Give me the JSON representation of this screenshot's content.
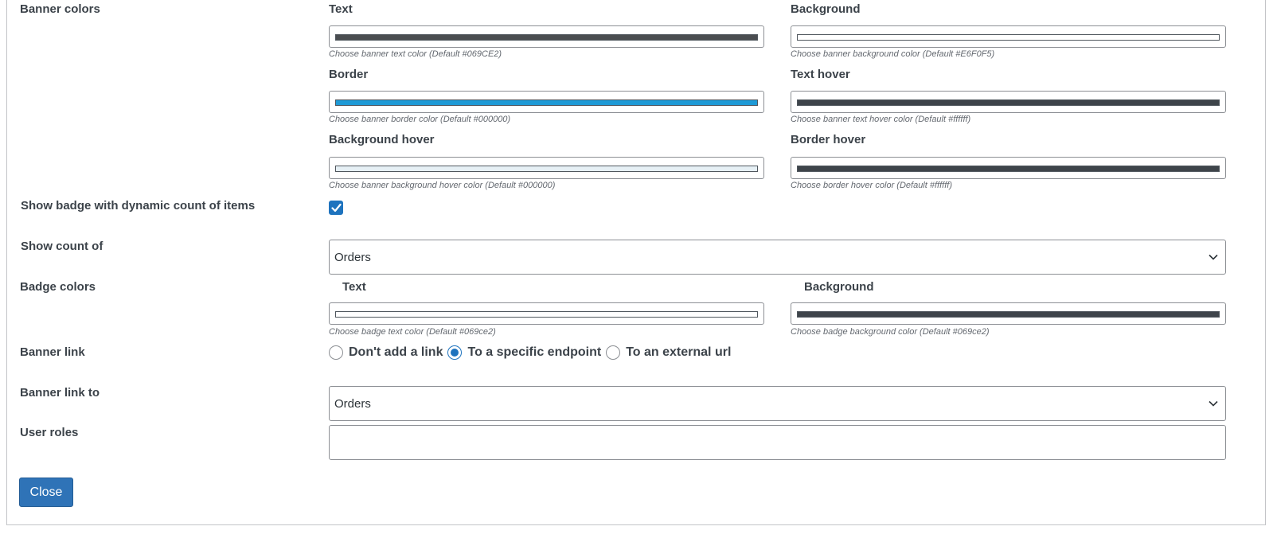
{
  "banner_colors": {
    "label": "Banner colors",
    "fields": [
      {
        "label": "Text",
        "hint": "Choose banner text color (Default #069CE2)",
        "swatch": "#4a4d50"
      },
      {
        "label": "Background",
        "hint": "Choose banner background color (Default #E6F0F5)",
        "swatch": "#ffffff"
      },
      {
        "label": "Border",
        "hint": "Choose banner border color (Default #000000)",
        "swatch": "#1e9ad6"
      },
      {
        "label": "Text hover",
        "hint": "Choose banner text hover color (Default #ffffff)",
        "swatch": "#3e444a"
      },
      {
        "label": "Background hover",
        "hint": "Choose banner background hover color (Default #000000)",
        "swatch": "#e6f0f5"
      },
      {
        "label": "Border hover",
        "hint": "Choose border hover color (Default #ffffff)",
        "swatch": "#3e444a"
      }
    ]
  },
  "badge_toggle": {
    "label": "Show badge with dynamic count of items",
    "checked": true
  },
  "show_count": {
    "label": "Show count of",
    "value": "Orders"
  },
  "badge_colors": {
    "label": "Badge colors",
    "fields": [
      {
        "label": "Text",
        "hint": "Choose badge text color (Default #069ce2)",
        "swatch": "#ffffff"
      },
      {
        "label": "Background",
        "hint": "Choose badge background color (Default #069ce2)",
        "swatch": "#3e444a"
      }
    ]
  },
  "banner_link": {
    "label": "Banner link",
    "options": [
      "Don't add a link",
      "To a specific endpoint",
      "To an external url"
    ],
    "selected": "To a specific endpoint"
  },
  "banner_link_to": {
    "label": "Banner link to",
    "value": "Orders"
  },
  "user_roles": {
    "label": "User roles",
    "value": ""
  },
  "close_button": {
    "label": "Close"
  },
  "colors": {
    "accent": "#1e73be",
    "button": "#2f73b7"
  }
}
